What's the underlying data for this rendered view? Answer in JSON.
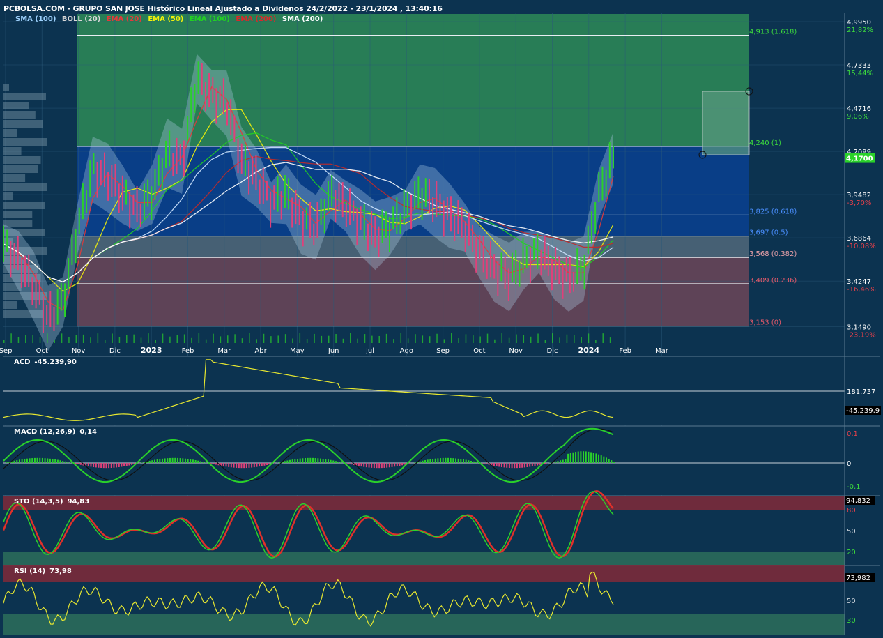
{
  "header": {
    "title": "PCBOLSA.COM - GRUPO SAN JOSE Histórico Lineal Ajustado a Dividenos 24/2/2022 - 23/1/2024 , 13:40:16"
  },
  "legend": [
    {
      "label": "SMA (100)",
      "color": "#9fd3ff"
    },
    {
      "label": "BOLL (20)",
      "color": "#d9d9d9"
    },
    {
      "label": "EMA (20)",
      "color": "#e23a3a"
    },
    {
      "label": "EMA (50)",
      "color": "#f2f20a"
    },
    {
      "label": "EMA (100)",
      "color": "#22d022"
    },
    {
      "label": "EMA (200)",
      "color": "#d62a2a"
    },
    {
      "label": "SMA (200)",
      "color": "#ffffff"
    }
  ],
  "panels": {
    "acd": {
      "name": "ACD",
      "value": "-45.239,90",
      "ticks": [
        "181.737"
      ],
      "last_label": "-45.239,9"
    },
    "macd": {
      "name": "MACD (12,26,9)",
      "value": "0,14",
      "ticks": [
        "0,1",
        "0",
        "-0,1"
      ]
    },
    "sto": {
      "name": "STO (14,3,5)",
      "value": "94,83",
      "ticks": [
        "80",
        "50",
        "20"
      ],
      "last_label": "94,832"
    },
    "rsi": {
      "name": "RSI (14)",
      "value": "73,98",
      "ticks": [
        "50",
        "30"
      ],
      "last_label": "73,982"
    }
  },
  "chart_data": {
    "type": "line",
    "title": "PCBOLSA.COM - GRUPO SAN JOSE Histórico Lineal Ajustado a Dividenos 24/2/2022 - 23/1/2024 , 13:40:16",
    "x_ticks": [
      "Sep",
      "Oct",
      "Nov",
      "Dic",
      "2023",
      "Feb",
      "Mar",
      "Abr",
      "May",
      "Jun",
      "Jul",
      "Ago",
      "Sep",
      "Oct",
      "Nov",
      "Dic",
      "2024",
      "Feb",
      "Mar"
    ],
    "price_axis": {
      "ticks": [
        {
          "value": 4.995,
          "label": "4,9950",
          "pct": "21,82%"
        },
        {
          "value": 4.7333,
          "label": "4,7333",
          "pct": "15,44%"
        },
        {
          "value": 4.4716,
          "label": "4,4716",
          "pct": "9,06%"
        },
        {
          "value": 4.2099,
          "label": "4,2099",
          "pct": ""
        },
        {
          "value": 3.9482,
          "label": "3,9482",
          "pct": "-3,70%"
        },
        {
          "value": 3.6864,
          "label": "3,6864",
          "pct": "-10,08%"
        },
        {
          "value": 3.4247,
          "label": "3,4247",
          "pct": "-16,46%"
        },
        {
          "value": 3.149,
          "label": "3,1490",
          "pct": "-23,19%"
        }
      ],
      "last": {
        "value": 4.17,
        "label": "4,1700"
      }
    },
    "fibonacci": [
      {
        "value": 4.913,
        "label": "4,913 (1.618)",
        "color": "#3ddc3d"
      },
      {
        "value": 4.24,
        "label": "4,240 (1)",
        "color": "#3ddc3d"
      },
      {
        "value": 3.825,
        "label": "3,825 (0.618)",
        "color": "#4a8fff"
      },
      {
        "value": 3.697,
        "label": "3,697 (0.5)",
        "color": "#4a8fff"
      },
      {
        "value": 3.568,
        "label": "3,568 (0.382)",
        "color": "#e8a0a8"
      },
      {
        "value": 3.409,
        "label": "3,409 (0.236)",
        "color": "#e85a6a"
      },
      {
        "value": 3.153,
        "label": "3,153 (0)",
        "color": "#e85a6a"
      }
    ],
    "series": [
      {
        "name": "Close",
        "values": [
          3.65,
          3.55,
          3.4,
          3.2,
          3.3,
          3.75,
          4.1,
          4.05,
          3.95,
          3.85,
          3.95,
          4.2,
          4.15,
          4.65,
          4.55,
          4.5,
          4.15,
          4.05,
          3.9,
          3.95,
          3.8,
          3.75,
          3.95,
          3.88,
          3.78,
          3.7,
          3.76,
          3.85,
          3.95,
          3.9,
          3.82,
          3.75,
          3.6,
          3.5,
          3.45,
          3.55,
          3.6,
          3.5,
          3.45,
          3.5,
          3.95,
          4.17
        ]
      }
    ],
    "grid": true,
    "colors": {
      "background": "#0c3350",
      "up": "#2ad12a",
      "down": "#e0407a"
    }
  }
}
